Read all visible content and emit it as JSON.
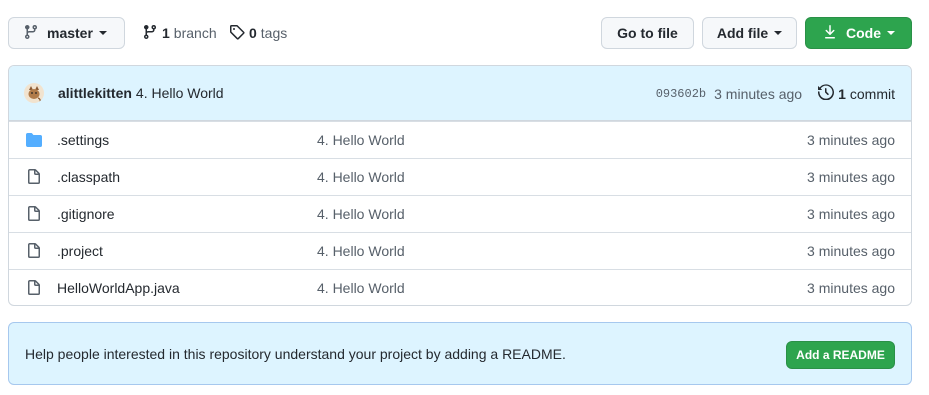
{
  "toolbar": {
    "branch_selector": {
      "label": "master"
    },
    "branches": {
      "count": "1",
      "label": "branch"
    },
    "tags": {
      "count": "0",
      "label": "tags"
    },
    "goto_file": "Go to file",
    "add_file": "Add file",
    "code": "Code"
  },
  "commit": {
    "author": "alittlekitten",
    "message": "4. Hello World",
    "sha": "093602b",
    "time": "3 minutes ago",
    "commit_count": "1",
    "commit_label": "commit"
  },
  "files": [
    {
      "name": ".settings",
      "type": "folder",
      "message": "4. Hello World",
      "time": "3 minutes ago"
    },
    {
      "name": ".classpath",
      "type": "file",
      "message": "4. Hello World",
      "time": "3 minutes ago"
    },
    {
      "name": ".gitignore",
      "type": "file",
      "message": "4. Hello World",
      "time": "3 minutes ago"
    },
    {
      "name": ".project",
      "type": "file",
      "message": "4. Hello World",
      "time": "3 minutes ago"
    },
    {
      "name": "HelloWorldApp.java",
      "type": "file",
      "message": "4. Hello World",
      "time": "3 minutes ago"
    }
  ],
  "readme": {
    "text": "Help people interested in this repository understand your project by adding a README.",
    "button": "Add a README"
  },
  "colors": {
    "primary_green": "#2da44e",
    "commit_bar_bg": "#ddf4ff",
    "folder_blue": "#54aeff",
    "muted_text": "#57606a"
  }
}
